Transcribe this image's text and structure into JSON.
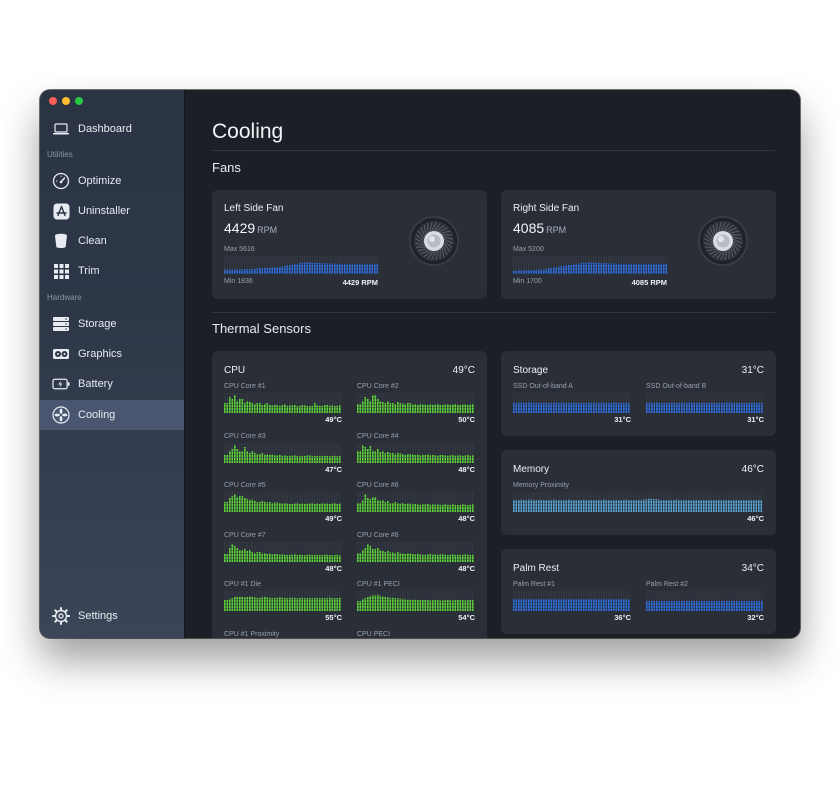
{
  "sidebar": {
    "dashboard": "Dashboard",
    "utilities_label": "Utilities",
    "optimize": "Optimize",
    "uninstaller": "Uninstaller",
    "clean": "Clean",
    "trim": "Trim",
    "hardware_label": "Hardware",
    "storage": "Storage",
    "graphics": "Graphics",
    "battery": "Battery",
    "cooling": "Cooling",
    "settings": "Settings"
  },
  "page_title": "Cooling",
  "fans_title": "Fans",
  "thermal_title": "Thermal Sensors",
  "fans": [
    {
      "name": "Left Side Fan",
      "rpm": "4429",
      "unit": "RPM",
      "max": "Max 5616",
      "min": "Min 1836",
      "current": "4429 RPM",
      "history": [
        0.25,
        0.25,
        0.26,
        0.25,
        0.26,
        0.27,
        0.26,
        0.28,
        0.3,
        0.32,
        0.33,
        0.34,
        0.36,
        0.38,
        0.4,
        0.44,
        0.48,
        0.52,
        0.55,
        0.6,
        0.62,
        0.64,
        0.63,
        0.62,
        0.6,
        0.6,
        0.58,
        0.57,
        0.56,
        0.56,
        0.55,
        0.55,
        0.54,
        0.54,
        0.55,
        0.54,
        0.54,
        0.55,
        0.54,
        0.55
      ]
    },
    {
      "name": "Right Side Fan",
      "rpm": "4085",
      "unit": "RPM",
      "max": "Max 5200",
      "min": "Min 1700",
      "current": "4085 RPM",
      "history": [
        0.18,
        0.2,
        0.2,
        0.21,
        0.22,
        0.22,
        0.24,
        0.25,
        0.28,
        0.32,
        0.36,
        0.4,
        0.44,
        0.48,
        0.5,
        0.52,
        0.56,
        0.6,
        0.62,
        0.64,
        0.63,
        0.62,
        0.6,
        0.6,
        0.58,
        0.58,
        0.57,
        0.56,
        0.56,
        0.55,
        0.55,
        0.55,
        0.54,
        0.55,
        0.55,
        0.54,
        0.55,
        0.55,
        0.55,
        0.55
      ]
    }
  ],
  "cpu": {
    "title": "CPU",
    "temp": "49°C",
    "sensors": [
      {
        "name": "CPU Core #1",
        "temp": "49°C",
        "levels": [
          0.5,
          0.8,
          0.7,
          0.9,
          0.6,
          0.7,
          0.5,
          0.6,
          0.55,
          0.5,
          0.45,
          0.5,
          0.4,
          0.45,
          0.5,
          0.4,
          0.38,
          0.4,
          0.35,
          0.4,
          0.42,
          0.36,
          0.38,
          0.4,
          0.35,
          0.36,
          0.4,
          0.38,
          0.35,
          0.36,
          0.5,
          0.38,
          0.36,
          0.35,
          0.4,
          0.36,
          0.38,
          0.35,
          0.36,
          0.38
        ]
      },
      {
        "name": "CPU Core #2",
        "temp": "50°C",
        "levels": [
          0.45,
          0.6,
          0.8,
          0.7,
          0.6,
          0.9,
          0.7,
          0.6,
          0.55,
          0.5,
          0.6,
          0.5,
          0.45,
          0.55,
          0.5,
          0.48,
          0.45,
          0.5,
          0.42,
          0.45,
          0.4,
          0.45,
          0.42,
          0.4,
          0.44,
          0.4,
          0.42,
          0.45,
          0.4,
          0.42,
          0.44,
          0.4,
          0.42,
          0.45,
          0.4,
          0.42,
          0.44,
          0.4,
          0.42,
          0.45
        ]
      },
      {
        "name": "CPU Core #3",
        "temp": "47°C",
        "levels": [
          0.4,
          0.6,
          0.7,
          0.9,
          0.7,
          0.6,
          0.8,
          0.6,
          0.5,
          0.6,
          0.5,
          0.45,
          0.5,
          0.4,
          0.45,
          0.4,
          0.42,
          0.38,
          0.4,
          0.36,
          0.38,
          0.35,
          0.36,
          0.38,
          0.35,
          0.34,
          0.36,
          0.35,
          0.38,
          0.34,
          0.36,
          0.35,
          0.34,
          0.36,
          0.35,
          0.34,
          0.35,
          0.36,
          0.34,
          0.35
        ]
      },
      {
        "name": "CPU Core #4",
        "temp": "48°C",
        "levels": [
          0.6,
          0.9,
          0.8,
          0.7,
          0.85,
          0.6,
          0.7,
          0.55,
          0.6,
          0.5,
          0.55,
          0.5,
          0.45,
          0.5,
          0.48,
          0.45,
          0.4,
          0.45,
          0.42,
          0.4,
          0.42,
          0.38,
          0.4,
          0.42,
          0.38,
          0.4,
          0.38,
          0.36,
          0.4,
          0.38,
          0.36,
          0.38,
          0.4,
          0.36,
          0.38,
          0.36,
          0.38,
          0.4,
          0.36,
          0.38
        ]
      },
      {
        "name": "CPU Core #5",
        "temp": "49°C",
        "levels": [
          0.5,
          0.7,
          0.8,
          0.9,
          0.75,
          0.8,
          0.7,
          0.65,
          0.6,
          0.62,
          0.55,
          0.5,
          0.55,
          0.5,
          0.48,
          0.5,
          0.45,
          0.48,
          0.45,
          0.42,
          0.45,
          0.42,
          0.4,
          0.42,
          0.44,
          0.4,
          0.42,
          0.4,
          0.42,
          0.44,
          0.4,
          0.42,
          0.4,
          0.44,
          0.42,
          0.4,
          0.42,
          0.44,
          0.4,
          0.42
        ]
      },
      {
        "name": "CPU Core #6",
        "temp": "48°C",
        "levels": [
          0.45,
          0.6,
          0.9,
          0.7,
          0.65,
          0.75,
          0.6,
          0.55,
          0.6,
          0.5,
          0.55,
          0.45,
          0.5,
          0.45,
          0.42,
          0.45,
          0.4,
          0.42,
          0.38,
          0.4,
          0.38,
          0.36,
          0.38,
          0.4,
          0.36,
          0.38,
          0.36,
          0.38,
          0.36,
          0.38,
          0.36,
          0.35,
          0.38,
          0.36,
          0.35,
          0.38,
          0.36,
          0.35,
          0.36,
          0.38
        ]
      },
      {
        "name": "CPU Core #7",
        "temp": "48°C",
        "levels": [
          0.4,
          0.7,
          0.9,
          0.8,
          0.7,
          0.6,
          0.65,
          0.55,
          0.6,
          0.5,
          0.45,
          0.5,
          0.42,
          0.45,
          0.4,
          0.42,
          0.38,
          0.4,
          0.36,
          0.38,
          0.36,
          0.35,
          0.36,
          0.38,
          0.35,
          0.36,
          0.35,
          0.34,
          0.36,
          0.35,
          0.34,
          0.36,
          0.35,
          0.34,
          0.36,
          0.35,
          0.34,
          0.35,
          0.36,
          0.34
        ]
      },
      {
        "name": "CPU Core #8",
        "temp": "48°C",
        "levels": [
          0.45,
          0.6,
          0.7,
          0.9,
          0.8,
          0.65,
          0.7,
          0.6,
          0.55,
          0.5,
          0.55,
          0.48,
          0.45,
          0.5,
          0.45,
          0.42,
          0.4,
          0.42,
          0.4,
          0.38,
          0.4,
          0.38,
          0.36,
          0.38,
          0.4,
          0.36,
          0.38,
          0.36,
          0.38,
          0.36,
          0.35,
          0.36,
          0.38,
          0.35,
          0.36,
          0.35,
          0.38,
          0.36,
          0.35,
          0.36
        ]
      },
      {
        "name": "CPU #1 Die",
        "temp": "55°C",
        "levels": [
          0.55,
          0.6,
          0.65,
          0.7,
          0.72,
          0.7,
          0.68,
          0.7,
          0.72,
          0.7,
          0.68,
          0.66,
          0.68,
          0.7,
          0.68,
          0.66,
          0.65,
          0.66,
          0.68,
          0.66,
          0.65,
          0.64,
          0.66,
          0.65,
          0.64,
          0.65,
          0.66,
          0.64,
          0.65,
          0.64,
          0.66,
          0.65,
          0.64,
          0.65,
          0.64,
          0.66,
          0.65,
          0.64,
          0.65,
          0.66
        ]
      },
      {
        "name": "CPU #1 PECI",
        "temp": "54°C",
        "levels": [
          0.5,
          0.58,
          0.65,
          0.7,
          0.75,
          0.78,
          0.8,
          0.76,
          0.72,
          0.7,
          0.68,
          0.66,
          0.65,
          0.64,
          0.62,
          0.6,
          0.58,
          0.56,
          0.55,
          0.56,
          0.55,
          0.54,
          0.55,
          0.54,
          0.53,
          0.54,
          0.55,
          0.54,
          0.53,
          0.54,
          0.55,
          0.54,
          0.53,
          0.54,
          0.55,
          0.54,
          0.53,
          0.54,
          0.55,
          0.54
        ]
      },
      {
        "name": "CPU #1 Proximity",
        "temp": ""
      },
      {
        "name": "CPU PECI",
        "temp": ""
      }
    ]
  },
  "storage": {
    "title": "Storage",
    "temp": "31°C",
    "sensors": [
      {
        "name": "SSD Out-of-band A",
        "temp": "31°C",
        "levels": [
          0.5,
          0.5,
          0.52,
          0.5,
          0.5,
          0.52,
          0.5,
          0.5,
          0.5,
          0.5,
          0.52,
          0.5,
          0.5,
          0.5,
          0.52,
          0.5,
          0.5,
          0.5,
          0.5,
          0.5,
          0.52,
          0.5,
          0.5,
          0.5,
          0.5,
          0.52,
          0.5,
          0.5,
          0.5,
          0.5,
          0.5,
          0.5,
          0.5,
          0.5,
          0.52,
          0.5,
          0.5,
          0.5,
          0.5,
          0.5
        ]
      },
      {
        "name": "SSD Out-of-band B",
        "temp": "31°C",
        "levels": [
          0.5,
          0.5,
          0.5,
          0.52,
          0.5,
          0.5,
          0.5,
          0.5,
          0.52,
          0.5,
          0.5,
          0.5,
          0.5,
          0.5,
          0.52,
          0.5,
          0.5,
          0.5,
          0.5,
          0.52,
          0.5,
          0.5,
          0.5,
          0.5,
          0.5,
          0.5,
          0.5,
          0.52,
          0.5,
          0.5,
          0.5,
          0.5,
          0.5,
          0.5,
          0.5,
          0.5,
          0.52,
          0.5,
          0.5,
          0.5
        ]
      }
    ]
  },
  "memory": {
    "title": "Memory",
    "temp": "46°C",
    "sensors": [
      {
        "name": "Memory Proximity",
        "temp": "46°C",
        "levels": [
          0.6,
          0.6,
          0.62,
          0.6,
          0.6,
          0.62,
          0.6,
          0.6,
          0.6,
          0.62,
          0.6,
          0.6,
          0.6,
          0.62,
          0.6,
          0.6,
          0.6,
          0.6,
          0.62,
          0.6,
          0.6,
          0.6,
          0.6,
          0.62,
          0.6,
          0.6,
          0.6,
          0.6,
          0.6,
          0.6,
          0.62,
          0.6,
          0.6,
          0.6,
          0.6,
          0.6,
          0.6,
          0.62,
          0.6,
          0.6,
          0.6,
          0.6,
          0.6,
          0.62,
          0.64,
          0.66,
          0.66,
          0.64,
          0.62,
          0.6,
          0.6,
          0.6,
          0.6,
          0.6,
          0.62,
          0.6,
          0.6,
          0.6,
          0.6,
          0.6,
          0.6,
          0.6,
          0.6,
          0.6,
          0.6,
          0.6,
          0.6,
          0.6,
          0.6,
          0.6,
          0.6,
          0.6,
          0.6,
          0.6,
          0.6,
          0.6,
          0.6,
          0.6,
          0.6,
          0.6,
          0.6,
          0.6,
          0.6,
          0.6
        ]
      }
    ]
  },
  "palm": {
    "title": "Palm Rest",
    "temp": "34°C",
    "sensors": [
      {
        "name": "Palm Rest #1",
        "temp": "36°C",
        "levels": [
          0.6,
          0.6,
          0.6,
          0.6,
          0.6,
          0.6,
          0.6,
          0.6,
          0.6,
          0.6,
          0.6,
          0.6,
          0.6,
          0.6,
          0.6,
          0.6,
          0.6,
          0.6,
          0.6,
          0.6,
          0.6,
          0.6,
          0.6,
          0.6,
          0.6,
          0.6,
          0.6,
          0.6,
          0.6,
          0.6,
          0.6,
          0.6,
          0.6,
          0.6,
          0.6,
          0.6,
          0.6,
          0.6,
          0.6,
          0.6
        ]
      },
      {
        "name": "Palm Rest #2",
        "temp": "32°C",
        "levels": [
          0.5,
          0.5,
          0.5,
          0.5,
          0.5,
          0.5,
          0.5,
          0.5,
          0.5,
          0.5,
          0.5,
          0.5,
          0.5,
          0.5,
          0.5,
          0.5,
          0.5,
          0.5,
          0.5,
          0.5,
          0.5,
          0.5,
          0.5,
          0.5,
          0.5,
          0.5,
          0.5,
          0.5,
          0.5,
          0.5,
          0.5,
          0.5,
          0.5,
          0.5,
          0.5,
          0.5,
          0.5,
          0.5,
          0.5,
          0.5
        ]
      }
    ]
  },
  "colors": {
    "blue": "#2f6fe0",
    "green": "#5fd43a",
    "teal": "#5aa7d6",
    "track": "#3a404b"
  },
  "icons": [
    "laptop-icon",
    "gauge-icon",
    "app-store-icon",
    "bucket-icon",
    "grid-icon",
    "drive-icon",
    "gpu-icon",
    "battery-icon",
    "fan-icon",
    "gear-icon"
  ]
}
